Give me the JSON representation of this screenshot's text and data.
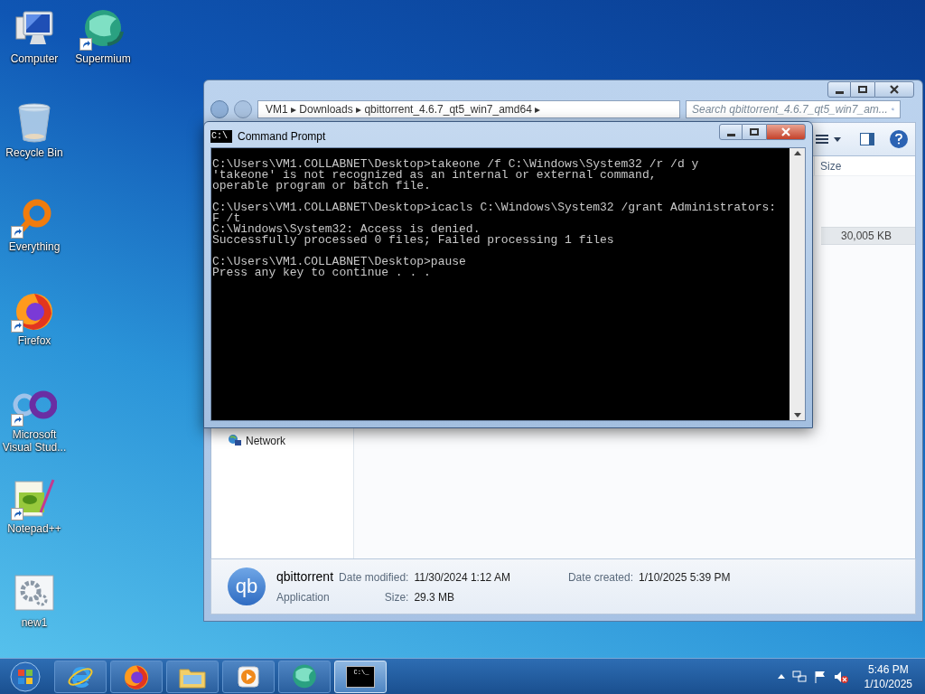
{
  "desktop": {
    "columns": [
      [
        {
          "label": "Computer",
          "kind": "computer",
          "shortcut": false
        },
        {
          "label": "Recycle Bin",
          "kind": "recycle_bin",
          "shortcut": false
        },
        {
          "label": "Everything",
          "kind": "everything",
          "shortcut": true
        },
        {
          "label": "Firefox",
          "kind": "firefox",
          "shortcut": true
        },
        {
          "label": "Microsoft Visual Stud...",
          "kind": "visual_studio",
          "shortcut": true
        },
        {
          "label": "Notepad++",
          "kind": "notepadpp",
          "shortcut": true
        },
        {
          "label": "new1",
          "kind": "settings_file",
          "shortcut": false
        }
      ],
      [
        {
          "label": "Supermium",
          "kind": "supermium",
          "shortcut": true
        }
      ]
    ]
  },
  "explorer": {
    "address": "VM1 ▸ Downloads ▸ qbittorrent_4.6.7_qt5_win7_amd64 ▸",
    "search_placeholder": "Search qbittorrent_4.6.7_qt5_win7_am...",
    "column_header": "Size",
    "rows": [
      {
        "size": "30,005 KB",
        "selected": true
      }
    ],
    "nav_items": [
      {
        "label": "Network"
      }
    ],
    "details": {
      "icon_text": "qb",
      "name": "qbittorrent",
      "type": "Application",
      "date_modified_label": "Date modified:",
      "date_modified": "11/30/2024 1:12 AM",
      "size_label": "Size:",
      "size": "29.3 MB",
      "date_created_label": "Date created:",
      "date_created": "1/10/2025 5:39 PM"
    }
  },
  "cmd": {
    "title": "Command Prompt",
    "icon_text": "C:\\",
    "blocks": [
      [
        "C:\\Users\\VM1.COLLABNET\\Desktop>takeone /f C:\\Windows\\System32 /r /d y",
        "'takeone' is not recognized as an internal or external command,",
        "operable program or batch file."
      ],
      [
        "C:\\Users\\VM1.COLLABNET\\Desktop>icacls C:\\Windows\\System32 /grant Administrators:",
        "F /t",
        "C:\\Windows\\System32: Access is denied.",
        "Successfully processed 0 files; Failed processing 1 files"
      ],
      [
        "C:\\Users\\VM1.COLLABNET\\Desktop>pause",
        "Press any key to continue . . ."
      ]
    ]
  },
  "taskbar": {
    "items": [
      {
        "kind": "ie",
        "selected": false
      },
      {
        "kind": "firefox",
        "selected": false
      },
      {
        "kind": "explorer",
        "selected": false
      },
      {
        "kind": "media",
        "selected": false
      },
      {
        "kind": "supermium",
        "selected": false
      },
      {
        "kind": "cmd",
        "selected": true,
        "icon_text": "C:\\_"
      }
    ],
    "time": "5:46 PM",
    "date": "1/10/2025"
  }
}
